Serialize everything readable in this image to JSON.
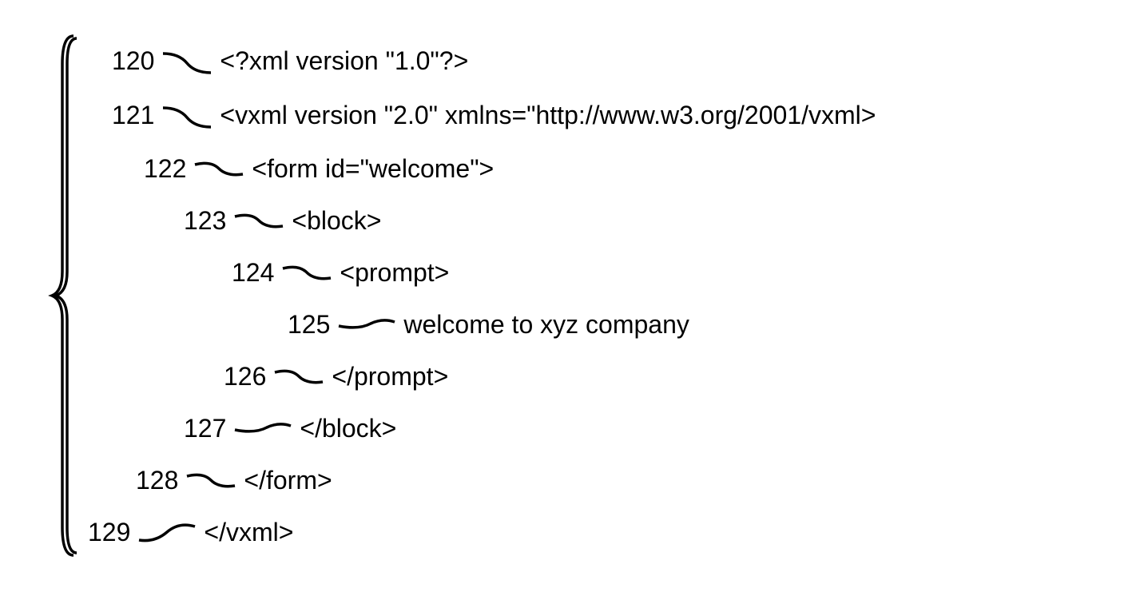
{
  "lines": [
    {
      "ref": "120",
      "code": "<?xml version \"1.0\"?>"
    },
    {
      "ref": "121",
      "code": "<vxml version \"2.0\" xmlns=\"http://www.w3.org/2001/vxml>"
    },
    {
      "ref": "122",
      "code": "<form id=\"welcome\">"
    },
    {
      "ref": "123",
      "code": "<block>"
    },
    {
      "ref": "124",
      "code": "<prompt>"
    },
    {
      "ref": "125",
      "code": "welcome to xyz company"
    },
    {
      "ref": "126",
      "code": "</prompt>"
    },
    {
      "ref": "127",
      "code": "</block>"
    },
    {
      "ref": "128",
      "code": "</form>"
    },
    {
      "ref": "129",
      "code": "</vxml>"
    }
  ]
}
